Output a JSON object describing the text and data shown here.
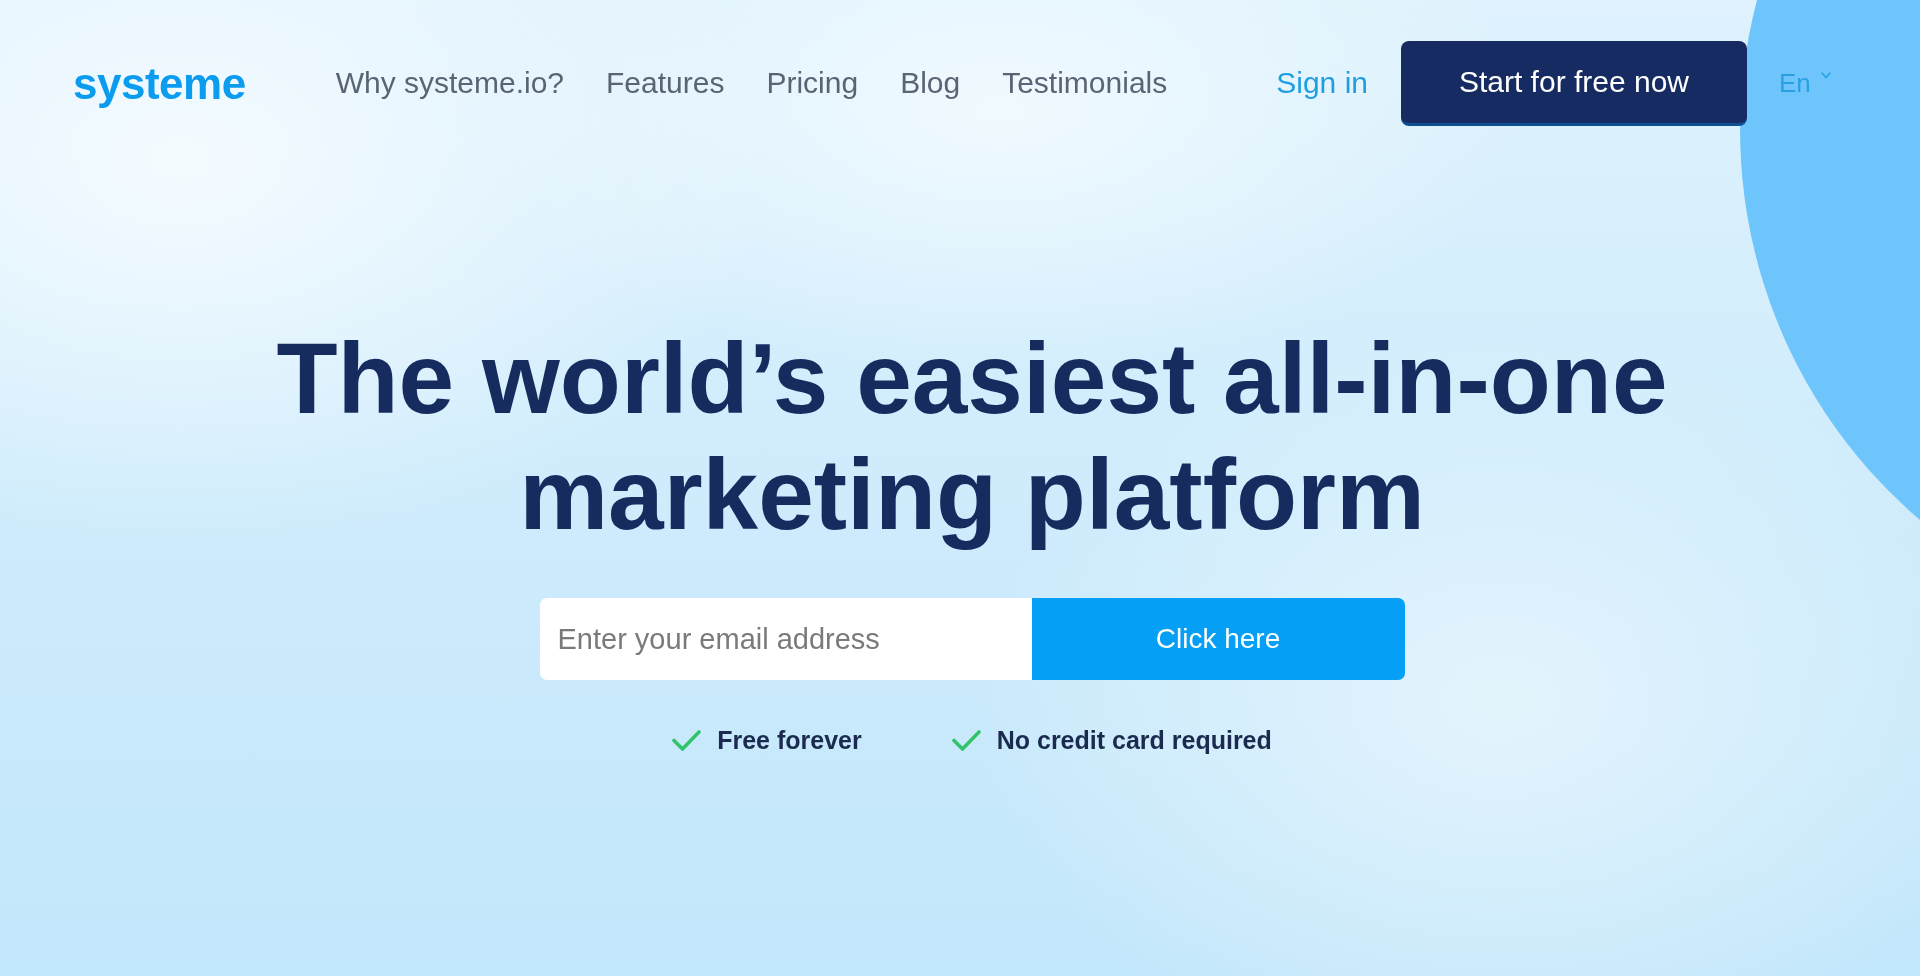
{
  "header": {
    "logo": "systeme",
    "nav_links": [
      "Why systeme.io?",
      "Features",
      "Pricing",
      "Blog",
      "Testimonials"
    ],
    "sign_in": "Sign in",
    "cta_button": "Start for free now",
    "language": "En"
  },
  "hero": {
    "headline": "The world’s easiest all-in-one marketing platform",
    "email_field": {
      "placeholder": "Enter your email address"
    },
    "submit_button": "Click here",
    "benefits": [
      "Free forever",
      "No credit card required"
    ]
  }
}
